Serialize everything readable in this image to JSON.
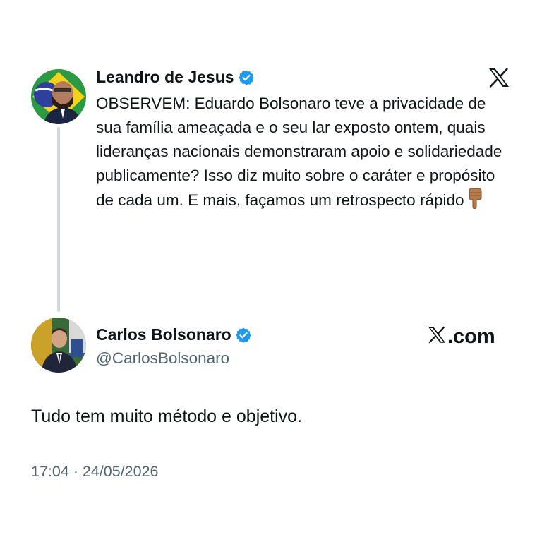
{
  "quoted_tweet": {
    "author_name": "Leandro de Jesus",
    "verified": true,
    "text": "OBSERVEM: Eduardo Bolsonaro teve a privacidade de sua família ameaçada e o seu lar exposto ontem, quais lideranças nacionais demonstraram apoio e solidariedade publicamente? Isso diz muito sobre o caráter e propósito de cada um. E mais, façamos um retrospecto rápido",
    "emoji_icon": "pointing-down-hand-icon"
  },
  "main_tweet": {
    "author_name": "Carlos Bolsonaro",
    "handle": "@CarlosBolsonaro",
    "verified": true,
    "text": "Tudo tem muito método e objetivo.",
    "timestamp": "17:04 · 24/05/2026"
  },
  "branding": {
    "x_logo_icon": "x-logo-icon",
    "site_suffix": ".com"
  },
  "colors": {
    "verified_blue": "#1d9bf0",
    "text_primary": "#0f1419",
    "text_secondary": "#536471",
    "thread_line": "#cfd9de"
  }
}
